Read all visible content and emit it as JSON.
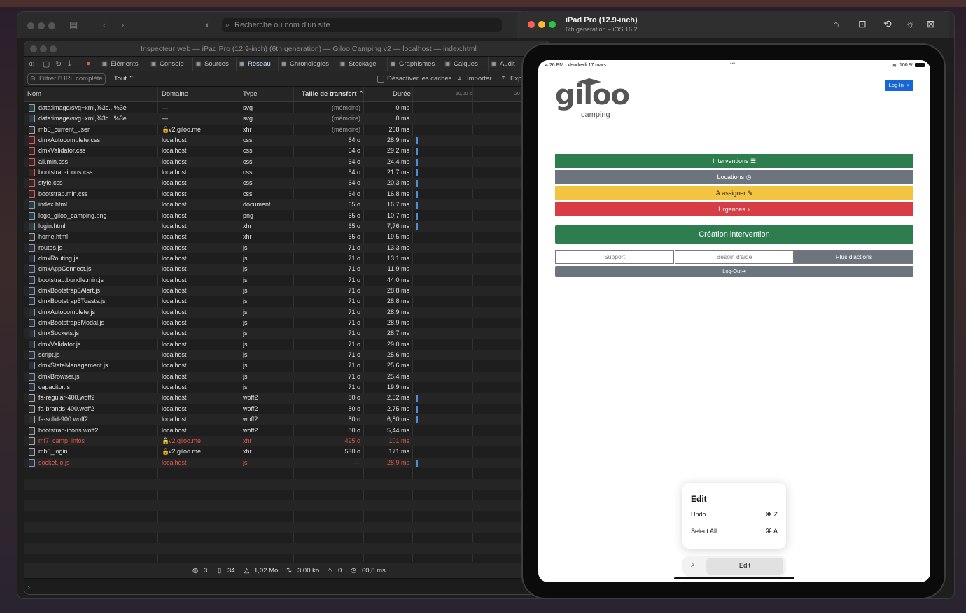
{
  "safari": {
    "url_placeholder": "Recherche ou nom d'un site"
  },
  "inspector": {
    "window_title": "Inspecteur web — iPad Pro (12.9-inch) (6th generation) — Giloo Camping v2 — localhost — index.html",
    "tabs": [
      {
        "label": "Éléments",
        "icon": "elements-icon"
      },
      {
        "label": "Console",
        "icon": "console-icon"
      },
      {
        "label": "Sources",
        "icon": "sources-icon"
      },
      {
        "label": "Réseau",
        "icon": "network-icon"
      },
      {
        "label": "Chronologies",
        "icon": "timeline-icon"
      },
      {
        "label": "Stockage",
        "icon": "storage-icon"
      },
      {
        "label": "Graphismes",
        "icon": "graphics-icon"
      },
      {
        "label": "Calques",
        "icon": "layers-icon"
      },
      {
        "label": "Audit",
        "icon": "audit-icon"
      },
      {
        "label": "Exp",
        "icon": "export-icon"
      }
    ],
    "active_tab": "Réseau",
    "filter_placeholder": "Filtrer l'URL complète",
    "type_filter": "Tout",
    "disable_cache_label": "Désactiver les caches",
    "import_label": "Importer",
    "export_label": "Exp",
    "columns": {
      "name": "Nom",
      "domain": "Domaine",
      "type": "Type",
      "transfer": "Taille de transfert",
      "duration": "Durée",
      "timeline_tick": "10,00 s",
      "timeline_tick2": "20"
    },
    "rows": [
      {
        "name": "data:image/svg+xml,%3c...%3e",
        "domain": "—",
        "type": "svg",
        "size": "(mémoire)",
        "time": "0 ms",
        "icon": "image",
        "lock": false,
        "error": false,
        "bar": false
      },
      {
        "name": "data:image/svg+xml,%3c...%3e",
        "domain": "—",
        "type": "svg",
        "size": "(mémoire)",
        "time": "0 ms",
        "icon": "image",
        "lock": false,
        "error": false,
        "bar": false
      },
      {
        "name": "mb5_current_user",
        "domain": "v2.giloo.me",
        "type": "xhr",
        "size": "(mémoire)",
        "time": "208 ms",
        "icon": "plain",
        "lock": true,
        "error": false,
        "bar": false
      },
      {
        "name": "dmxAutocomplete.css",
        "domain": "localhost",
        "type": "css",
        "size": "64 o",
        "time": "28,9 ms",
        "icon": "css",
        "lock": false,
        "error": false,
        "bar": true
      },
      {
        "name": "dmxValidator.css",
        "domain": "localhost",
        "type": "css",
        "size": "64 o",
        "time": "29,2 ms",
        "icon": "css",
        "lock": false,
        "error": false,
        "bar": true
      },
      {
        "name": "all.min.css",
        "domain": "localhost",
        "type": "css",
        "size": "64 o",
        "time": "24,4 ms",
        "icon": "css",
        "lock": false,
        "error": false,
        "bar": true
      },
      {
        "name": "bootstrap-icons.css",
        "domain": "localhost",
        "type": "css",
        "size": "64 o",
        "time": "21,7 ms",
        "icon": "css",
        "lock": false,
        "error": false,
        "bar": true
      },
      {
        "name": "style.css",
        "domain": "localhost",
        "type": "css",
        "size": "64 o",
        "time": "20,3 ms",
        "icon": "css",
        "lock": false,
        "error": false,
        "bar": true
      },
      {
        "name": "bootstrap.min.css",
        "domain": "localhost",
        "type": "css",
        "size": "64 o",
        "time": "16,8 ms",
        "icon": "css",
        "lock": false,
        "error": false,
        "bar": true
      },
      {
        "name": "index.html",
        "domain": "localhost",
        "type": "document",
        "size": "65 o",
        "time": "16,7 ms",
        "icon": "image",
        "lock": false,
        "error": false,
        "bar": true
      },
      {
        "name": "logo_giloo_camping.png",
        "domain": "localhost",
        "type": "png",
        "size": "65 o",
        "time": "10,7 ms",
        "icon": "image",
        "lock": false,
        "error": false,
        "bar": true
      },
      {
        "name": "login.html",
        "domain": "localhost",
        "type": "xhr",
        "size": "65 o",
        "time": "7,76 ms",
        "icon": "image",
        "lock": false,
        "error": false,
        "bar": true
      },
      {
        "name": "home.html",
        "domain": "localhost",
        "type": "xhr",
        "size": "65 o",
        "time": "19,5 ms",
        "icon": "plain",
        "lock": false,
        "error": false,
        "bar": false
      },
      {
        "name": "routes.js",
        "domain": "localhost",
        "type": "js",
        "size": "71 o",
        "time": "13,3 ms",
        "icon": "js",
        "lock": false,
        "error": false,
        "bar": false
      },
      {
        "name": "dmxRouting.js",
        "domain": "localhost",
        "type": "js",
        "size": "71 o",
        "time": "13,1 ms",
        "icon": "js",
        "lock": false,
        "error": false,
        "bar": false
      },
      {
        "name": "dmxAppConnect.js",
        "domain": "localhost",
        "type": "js",
        "size": "71 o",
        "time": "11,9 ms",
        "icon": "js",
        "lock": false,
        "error": false,
        "bar": false
      },
      {
        "name": "bootstrap.bundle.min.js",
        "domain": "localhost",
        "type": "js",
        "size": "71 o",
        "time": "44,0 ms",
        "icon": "js",
        "lock": false,
        "error": false,
        "bar": false
      },
      {
        "name": "dmxBootstrap5Alert.js",
        "domain": "localhost",
        "type": "js",
        "size": "71 o",
        "time": "28,8 ms",
        "icon": "js",
        "lock": false,
        "error": false,
        "bar": false
      },
      {
        "name": "dmxBootstrap5Toasts.js",
        "domain": "localhost",
        "type": "js",
        "size": "71 o",
        "time": "28,8 ms",
        "icon": "js",
        "lock": false,
        "error": false,
        "bar": false
      },
      {
        "name": "dmxAutocomplete.js",
        "domain": "localhost",
        "type": "js",
        "size": "71 o",
        "time": "28,9 ms",
        "icon": "js",
        "lock": false,
        "error": false,
        "bar": false
      },
      {
        "name": "dmxBootstrap5Modal.js",
        "domain": "localhost",
        "type": "js",
        "size": "71 o",
        "time": "28,9 ms",
        "icon": "js",
        "lock": false,
        "error": false,
        "bar": false
      },
      {
        "name": "dmxSockets.js",
        "domain": "localhost",
        "type": "js",
        "size": "71 o",
        "time": "28,7 ms",
        "icon": "js",
        "lock": false,
        "error": false,
        "bar": false
      },
      {
        "name": "dmxValidator.js",
        "domain": "localhost",
        "type": "js",
        "size": "71 o",
        "time": "29,0 ms",
        "icon": "js",
        "lock": false,
        "error": false,
        "bar": false
      },
      {
        "name": "script.js",
        "domain": "localhost",
        "type": "js",
        "size": "71 o",
        "time": "25,6 ms",
        "icon": "js",
        "lock": false,
        "error": false,
        "bar": false
      },
      {
        "name": "dmxStateManagement.js",
        "domain": "localhost",
        "type": "js",
        "size": "71 o",
        "time": "25,6 ms",
        "icon": "js",
        "lock": false,
        "error": false,
        "bar": false
      },
      {
        "name": "dmxBrowser.js",
        "domain": "localhost",
        "type": "js",
        "size": "71 o",
        "time": "25,4 ms",
        "icon": "js",
        "lock": false,
        "error": false,
        "bar": false
      },
      {
        "name": "capacitor.js",
        "domain": "localhost",
        "type": "js",
        "size": "71 o",
        "time": "19,9 ms",
        "icon": "js",
        "lock": false,
        "error": false,
        "bar": false
      },
      {
        "name": "fa-regular-400.woff2",
        "domain": "localhost",
        "type": "woff2",
        "size": "80 o",
        "time": "2,52 ms",
        "icon": "plain",
        "lock": false,
        "error": false,
        "bar": true
      },
      {
        "name": "fa-brands-400.woff2",
        "domain": "localhost",
        "type": "woff2",
        "size": "80 o",
        "time": "2,75 ms",
        "icon": "plain",
        "lock": false,
        "error": false,
        "bar": true
      },
      {
        "name": "fa-solid-900.woff2",
        "domain": "localhost",
        "type": "woff2",
        "size": "80 o",
        "time": "6,80 ms",
        "icon": "plain",
        "lock": false,
        "error": false,
        "bar": true
      },
      {
        "name": "bootstrap-icons.woff2",
        "domain": "localhost",
        "type": "woff2",
        "size": "80 o",
        "time": "5,44 ms",
        "icon": "plain",
        "lock": false,
        "error": false,
        "bar": false
      },
      {
        "name": "mf7_camp_infos",
        "domain": "v2.giloo.me",
        "type": "xhr",
        "size": "495 o",
        "time": "101 ms",
        "icon": "plain",
        "lock": true,
        "error": true,
        "bar": false
      },
      {
        "name": "mb5_login",
        "domain": "v2.giloo.me",
        "type": "xhr",
        "size": "530 o",
        "time": "171 ms",
        "icon": "plain",
        "lock": true,
        "error": false,
        "bar": false
      },
      {
        "name": "socket.io.js",
        "domain": "localhost",
        "type": "js",
        "size": "—",
        "time": "28,9 ms",
        "icon": "js",
        "lock": false,
        "error": true,
        "bar": true
      }
    ],
    "status": {
      "domains": "3",
      "requests": "34",
      "size": "1,02 Mo",
      "transferred": "3,00 ko",
      "errors": "0",
      "time": "60,8 ms"
    },
    "console_prompt": "›"
  },
  "simulator": {
    "device_title": "iPad Pro (12.9-inch)",
    "device_subtitle": "6th generation – iOS 16.2",
    "icons": [
      "home-icon",
      "screenshot-icon",
      "rotate-icon",
      "appearance-icon",
      "close-icon"
    ]
  },
  "ipad": {
    "time": "4:26 PM",
    "date": "Vendredi 17 mars",
    "dots": "•••",
    "battery": "100 %",
    "app": {
      "logo_text": "giloo",
      "logo_sub": ".camping",
      "login_label": "Log-In",
      "buttons": [
        {
          "label": "Interventions",
          "color": "#2e7d4f"
        },
        {
          "label": "Locations",
          "color": "#6c757d"
        },
        {
          "label": "À assigner",
          "color": "#f3c342"
        },
        {
          "label": "Urgences",
          "color": "#d63d44"
        }
      ],
      "create_label": "Création intervention",
      "group": {
        "support": "Support",
        "help": "Besoin d'aide",
        "more": "Plus d'actions"
      },
      "logout_label": "Log-Out"
    },
    "edit_menu": {
      "title": "Edit",
      "items": [
        {
          "label": "Undo",
          "shortcut": "⌘ Z"
        },
        {
          "label": "Select All",
          "shortcut": "⌘ A"
        }
      ],
      "search_icon": "search-icon",
      "edit_label": "Edit"
    }
  }
}
